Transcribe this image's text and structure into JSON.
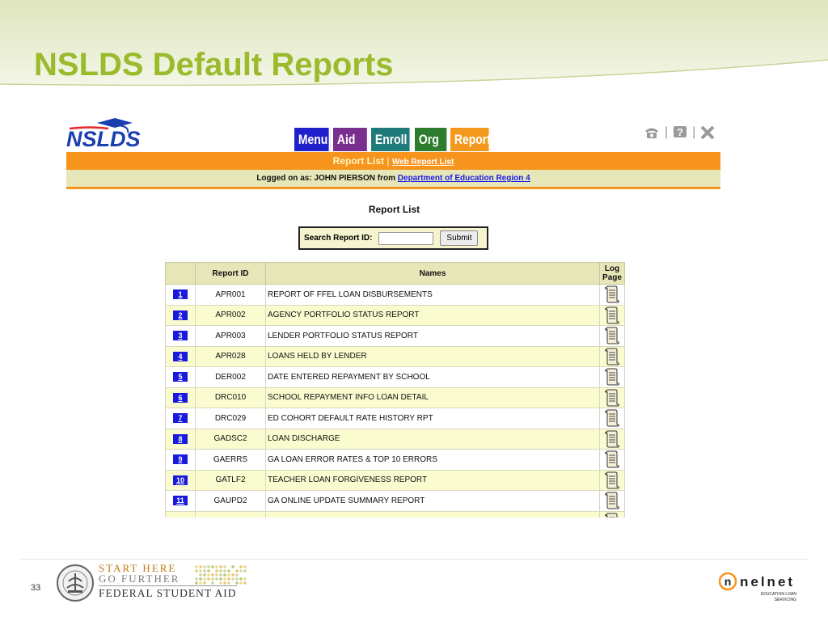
{
  "slide": {
    "title": "NSLDS Default Reports",
    "page_number": "33"
  },
  "app": {
    "logo_text": "NSLDS",
    "tabs": [
      "Menu",
      "Aid",
      "Enroll",
      "Org",
      "Report"
    ],
    "active_tab": "Report",
    "subnav": {
      "current": "Report List",
      "separator": "|",
      "link": "Web Report List"
    },
    "logon": {
      "prefix": "Logged on as: JOHN PIERSON from ",
      "org_link": "Department of Education Region 4"
    },
    "tools": [
      "phone-icon",
      "help-icon",
      "close-icon"
    ]
  },
  "report_list": {
    "heading": "Report List",
    "search": {
      "label": "Search Report ID:",
      "value": "",
      "button": "Submit"
    },
    "columns": {
      "num": "",
      "report_id": "Report ID",
      "names": "Names",
      "log_page_1": "Log",
      "log_page_2": "Page"
    },
    "rows": [
      {
        "num": "1",
        "id": "APR001",
        "name": "REPORT OF FFEL LOAN DISBURSEMENTS"
      },
      {
        "num": "2",
        "id": "APR002",
        "name": "AGENCY PORTFOLIO STATUS REPORT"
      },
      {
        "num": "3",
        "id": "APR003",
        "name": "LENDER PORTFOLIO STATUS REPORT"
      },
      {
        "num": "4",
        "id": "APR028",
        "name": "LOANS HELD BY LENDER"
      },
      {
        "num": "5",
        "id": "DER002",
        "name": "DATE ENTERED REPAYMENT BY SCHOOL"
      },
      {
        "num": "6",
        "id": "DRC010",
        "name": "SCHOOL REPAYMENT INFO LOAN DETAIL"
      },
      {
        "num": "7",
        "id": "DRC029",
        "name": "ED COHORT DEFAULT RATE HISTORY RPT"
      },
      {
        "num": "8",
        "id": "GADSC2",
        "name": "LOAN DISCHARGE"
      },
      {
        "num": "9",
        "id": "GAERRS",
        "name": "GA LOAN ERROR RATES & TOP 10 ERRORS"
      },
      {
        "num": "10",
        "id": "GATLF2",
        "name": "TEACHER LOAN FORGIVENESS REPORT"
      },
      {
        "num": "11",
        "id": "GAUPD2",
        "name": "GA ONLINE UPDATE SUMMARY REPORT"
      },
      {
        "num": "",
        "id": "",
        "name": ""
      }
    ]
  },
  "footer": {
    "fsa_line1": "START HERE",
    "fsa_line2": "GO FURTHER",
    "fsa_line3": "FEDERAL STUDENT AID",
    "nelnet": "nelnet",
    "nelnet_sub1": "EDUCATION LOAN",
    "nelnet_sub2": "SERVICING"
  },
  "colors": {
    "title": "#9bbb2c",
    "orange": "#f7941d",
    "tan": "#e6e6b8",
    "row_alt": "#fbfbd0",
    "num_badge": "#1a1adc"
  }
}
